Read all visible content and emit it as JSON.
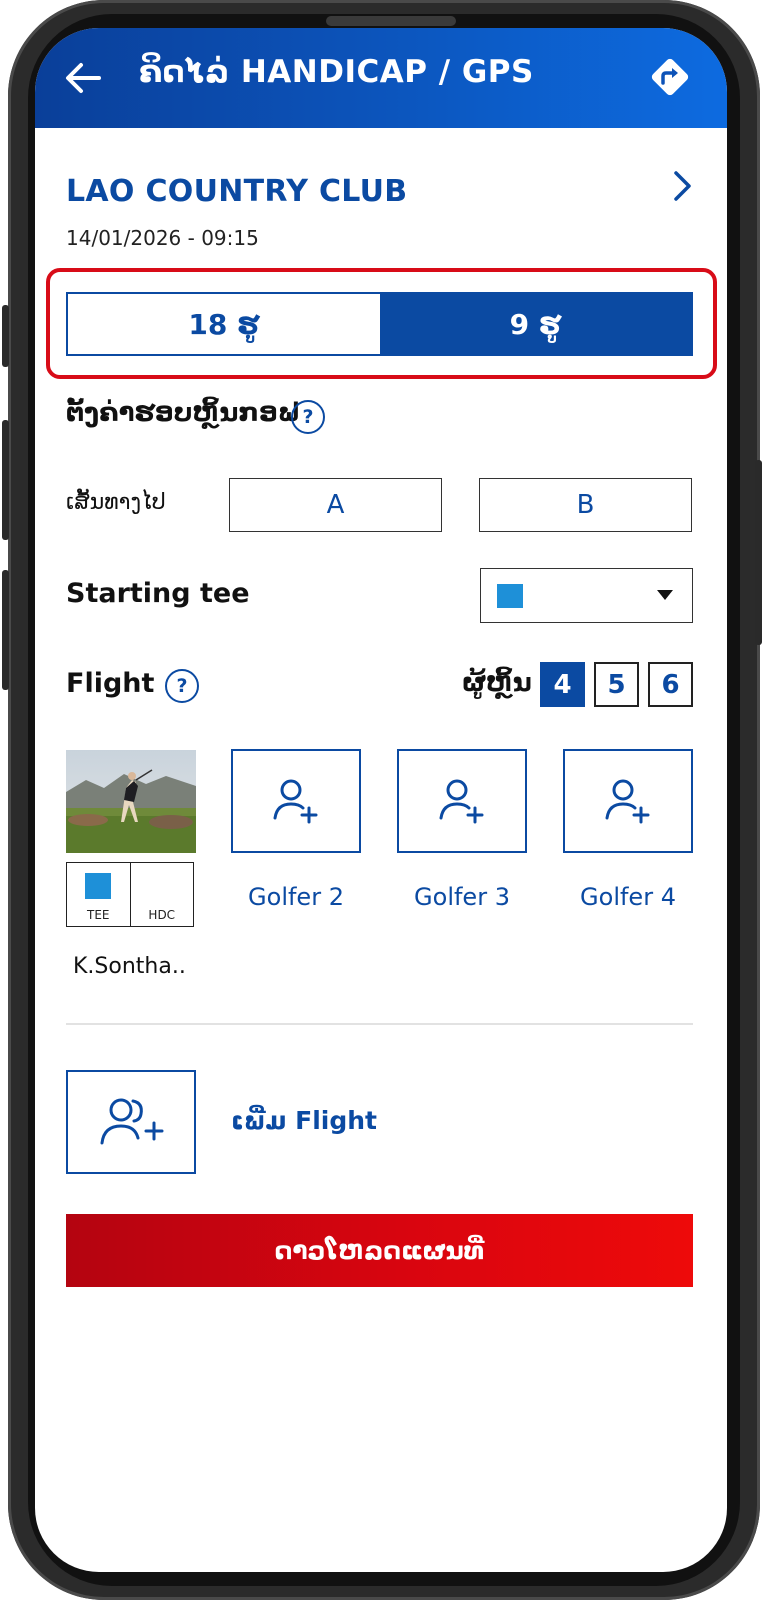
{
  "header": {
    "title": "ຄິດໄລ່ HANDICAP / GPS",
    "back_icon": "arrow-left-icon",
    "route_icon": "directions-icon"
  },
  "club": {
    "name": "LAO COUNTRY CLUB",
    "datetime": "14/01/2026 - 09:15"
  },
  "holes": {
    "options": [
      "18 ຮູ",
      "9 ຮູ"
    ],
    "selected": "9 ຮູ"
  },
  "round_setup": {
    "title": "ຕັ້ງຄ່າຮອບຫຼິ້ນກອຟ",
    "route_label": "ເສັ້ນທາງໄປ",
    "routes": [
      "A",
      "B"
    ],
    "starting_tee_label": "Starting tee",
    "starting_tee_color": "#1e90d8"
  },
  "flight": {
    "label": "Flight",
    "players_label": "ຜູ້ຫຼິ້ນ",
    "player_counts": [
      "4",
      "5",
      "6"
    ],
    "selected_count": "4",
    "golfer1": {
      "name": "K.Sontha..",
      "tee_caption": "TEE",
      "hdc_caption": "HDC",
      "tee_color": "#1e90d8"
    },
    "golfers": [
      "Golfer 2",
      "Golfer 3",
      "Golfer 4"
    ],
    "add_flight_label": "ເພີ່ມ Flight"
  },
  "download_label": "ດາວໂຫລດແຜນທີ່",
  "colors": {
    "primary": "#0b4aa2",
    "accent_red": "#d9050f",
    "highlight_border": "#d80c18"
  }
}
